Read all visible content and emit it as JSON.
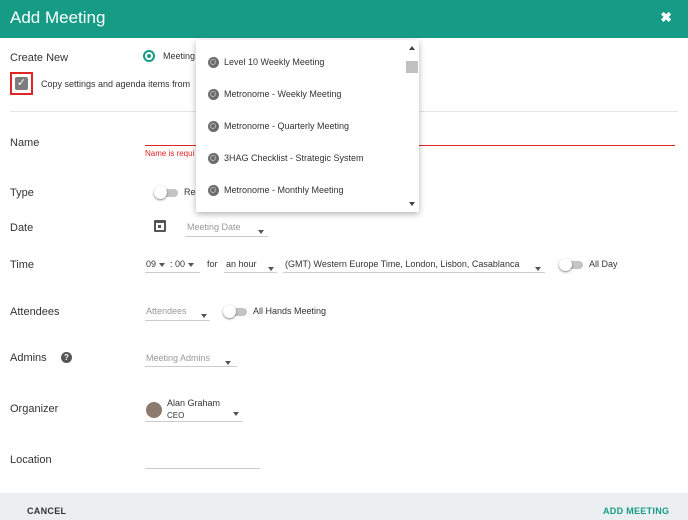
{
  "dialog": {
    "title": "Add Meeting",
    "close_icon": "✖"
  },
  "create_new": {
    "label": "Create New",
    "radio_label": "Meeting",
    "copy_checkbox_label": "Copy settings and agenda items from"
  },
  "name": {
    "label": "Name",
    "error": "Name is requi"
  },
  "type": {
    "label": "Type",
    "toggle_label": "Rec"
  },
  "date": {
    "label": "Date",
    "placeholder": "Meeting Date"
  },
  "time": {
    "label": "Time",
    "hour": "09",
    "minute": "00",
    "for_label": "for",
    "duration": "an hour",
    "timezone": "(GMT) Western Europe Time, London, Lisbon, Casablanca",
    "all_day_label": "All Day"
  },
  "attendees": {
    "label": "Attendees",
    "placeholder": "Attendees",
    "all_hands_label": "All Hands Meeting"
  },
  "admins": {
    "label": "Admins",
    "placeholder": "Meeting Admins"
  },
  "organizer": {
    "label": "Organizer",
    "name": "Alan Graham",
    "role": "CEO"
  },
  "location": {
    "label": "Location"
  },
  "footer": {
    "cancel": "CANCEL",
    "add": "ADD MEETING"
  },
  "dropdown": {
    "items": [
      "Level 10 Weekly Meeting",
      "Metronome - Weekly Meeting",
      "Metronome - Quarterly Meeting",
      "3HAG Checklist - Strategic System",
      "Metronome - Monthly Meeting"
    ]
  },
  "colors": {
    "header": "#159b86",
    "error": "#e02525"
  }
}
